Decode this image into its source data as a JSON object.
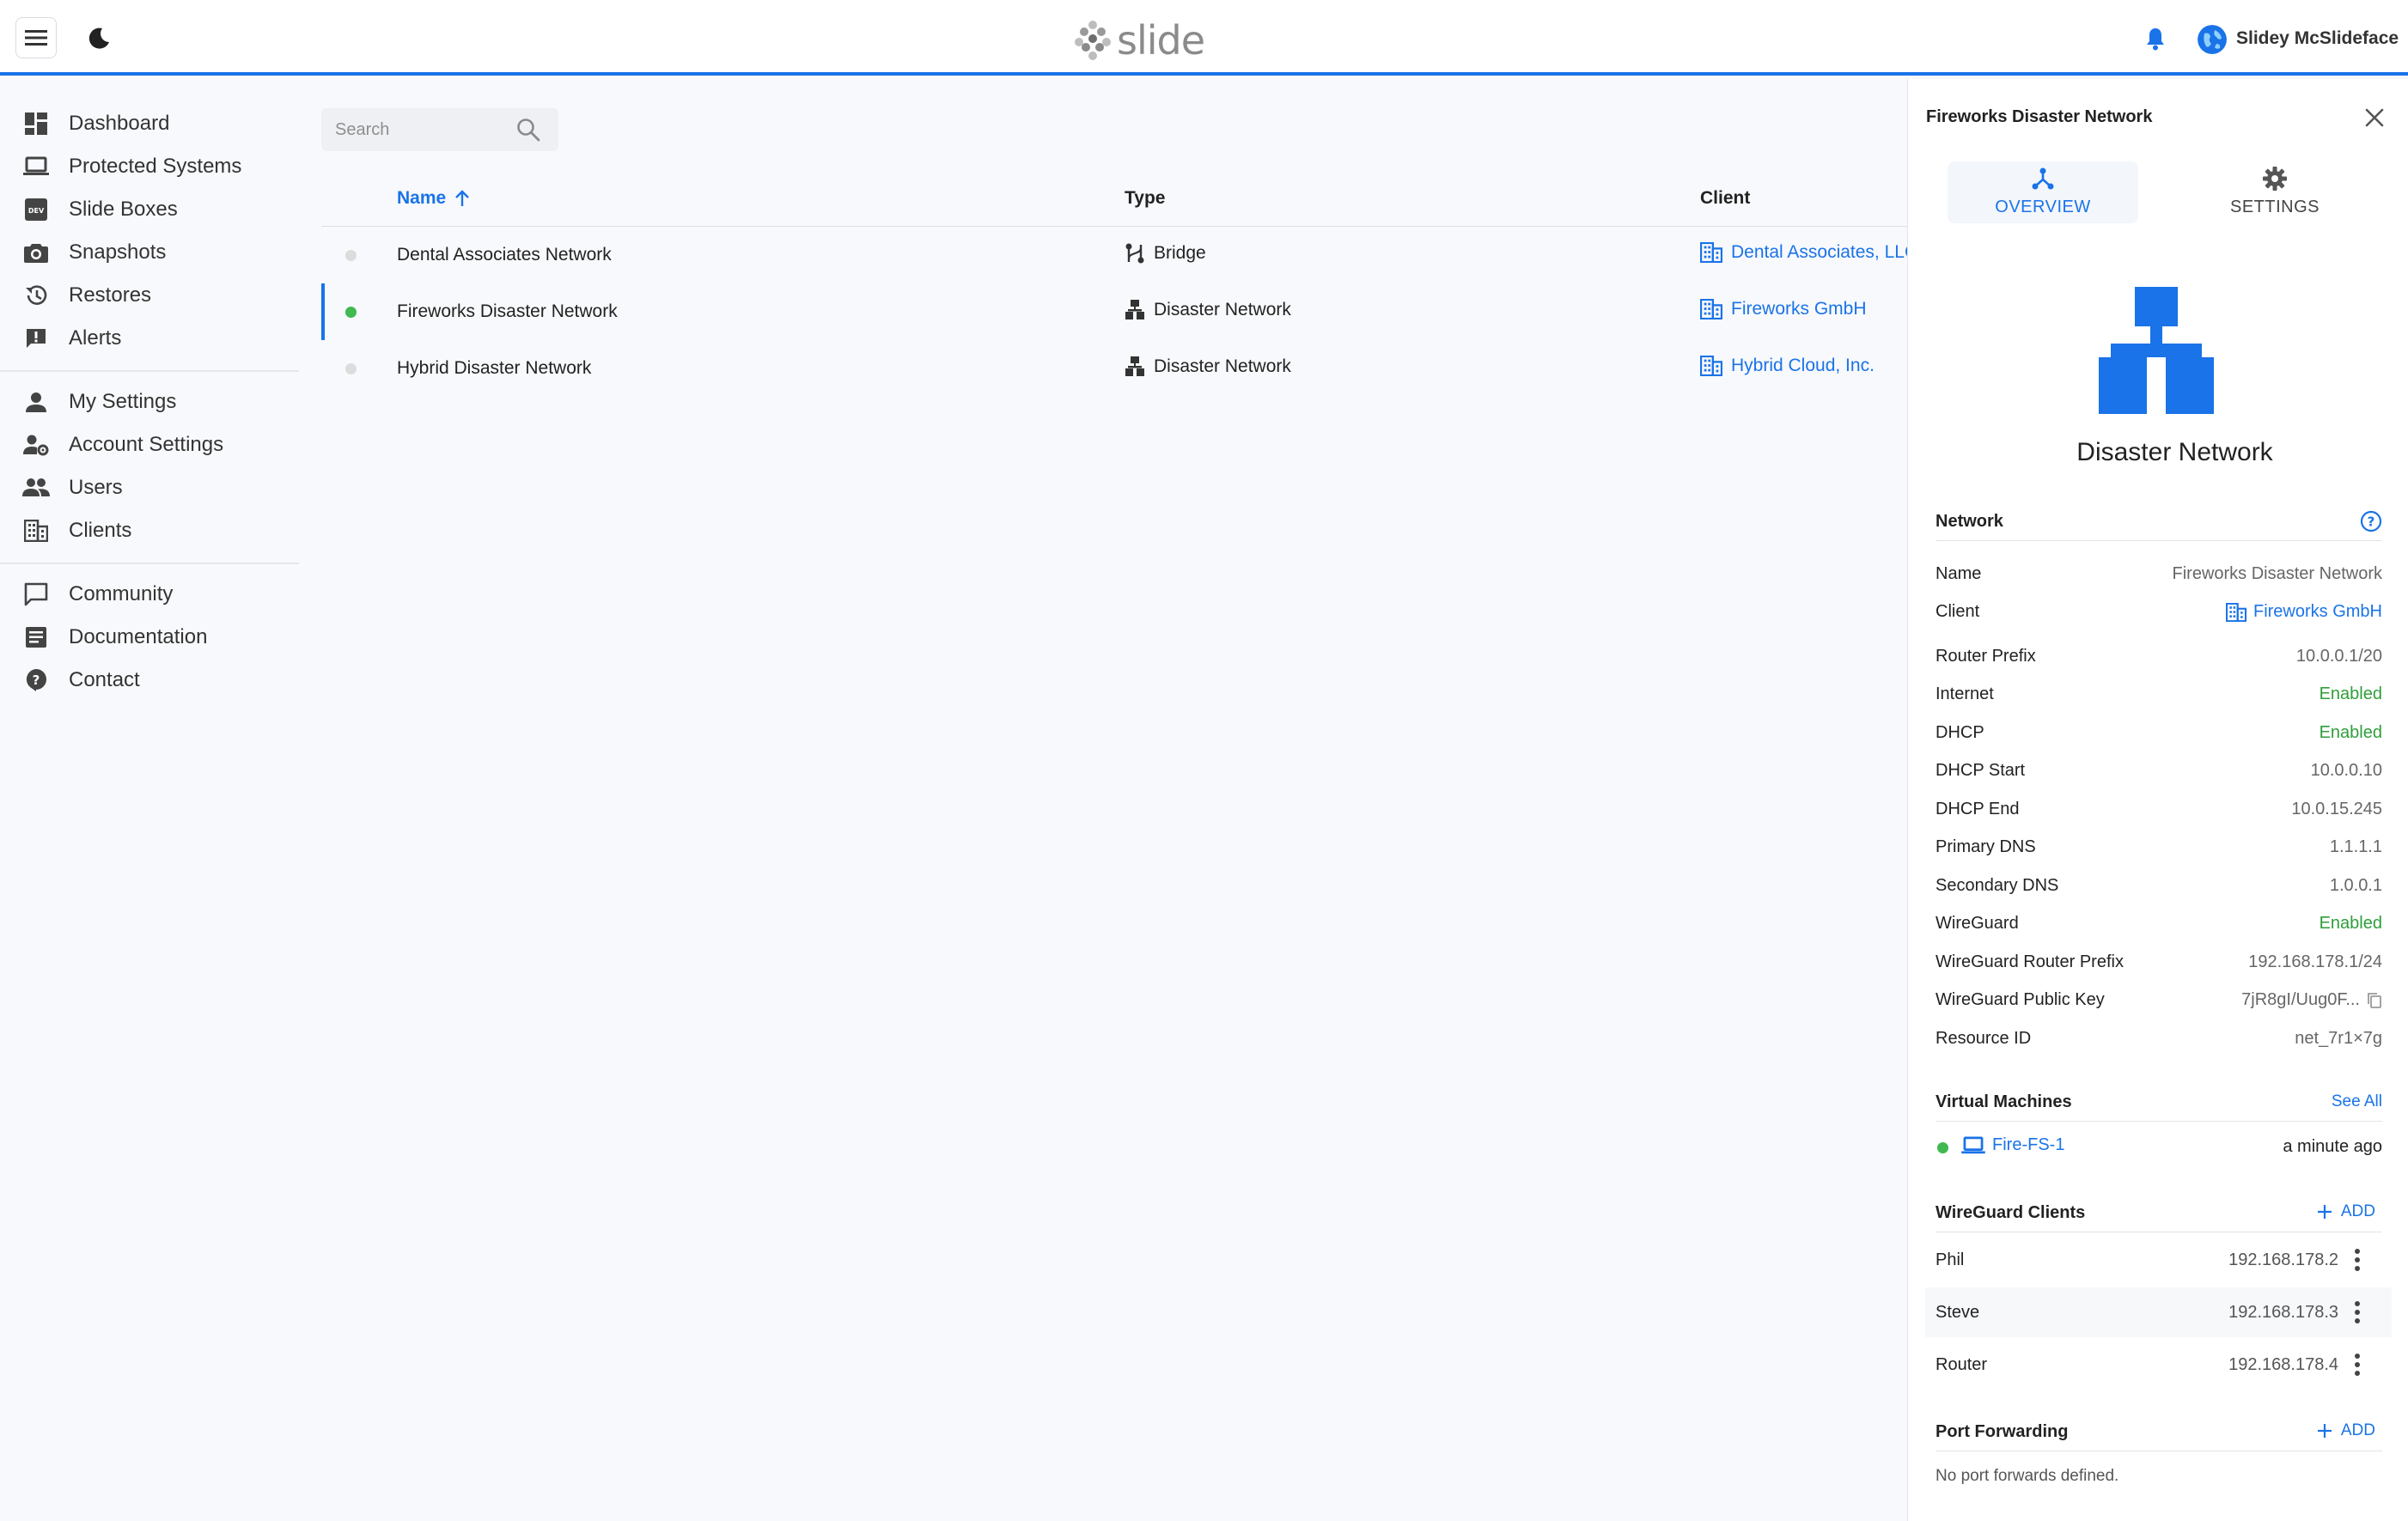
{
  "app": {
    "logo_text": "slide",
    "user_name": "Slidey McSlideface",
    "accent_color": "#1a73e8"
  },
  "sidebar": {
    "groups": [
      [
        {
          "label": "Dashboard",
          "icon": "dashboard-icon"
        },
        {
          "label": "Protected Systems",
          "icon": "laptop-icon"
        },
        {
          "label": "Slide Boxes",
          "icon": "dev-box-icon"
        },
        {
          "label": "Snapshots",
          "icon": "camera-icon"
        },
        {
          "label": "Restores",
          "icon": "history-icon"
        },
        {
          "label": "Alerts",
          "icon": "alert-icon"
        }
      ],
      [
        {
          "label": "My Settings",
          "icon": "person-icon"
        },
        {
          "label": "Account Settings",
          "icon": "person-gear-icon"
        },
        {
          "label": "Users",
          "icon": "users-icon"
        },
        {
          "label": "Clients",
          "icon": "building-icon"
        }
      ],
      [
        {
          "label": "Community",
          "icon": "chat-icon"
        },
        {
          "label": "Documentation",
          "icon": "document-icon"
        },
        {
          "label": "Contact",
          "icon": "help-bubble-icon"
        }
      ]
    ]
  },
  "search": {
    "placeholder": "Search",
    "value": ""
  },
  "table": {
    "columns": {
      "name": "Name",
      "type": "Type",
      "client": "Client"
    },
    "rows": [
      {
        "name": "Dental Associates Network",
        "type": "Bridge",
        "client": "Dental Associates, LLC",
        "status": "inactive",
        "selected": false
      },
      {
        "name": "Fireworks Disaster Network",
        "type": "Disaster Network",
        "client": "Fireworks GmbH",
        "status": "active",
        "selected": true
      },
      {
        "name": "Hybrid Disaster Network",
        "type": "Disaster Network",
        "client": "Hybrid Cloud, Inc.",
        "status": "inactive",
        "selected": false
      }
    ]
  },
  "panel": {
    "title": "Fireworks Disaster Network",
    "tabs": {
      "overview": "OVERVIEW",
      "settings": "SETTINGS"
    },
    "type_title": "Disaster Network",
    "network": {
      "heading": "Network",
      "fields": [
        {
          "key": "Name",
          "value": "Fireworks Disaster Network",
          "style": "plain"
        },
        {
          "key": "Client",
          "value": "Fireworks GmbH",
          "style": "link"
        },
        {
          "key": "Router Prefix",
          "value": "10.0.0.1/20",
          "style": "plain"
        },
        {
          "key": "Internet",
          "value": "Enabled",
          "style": "green"
        },
        {
          "key": "DHCP",
          "value": "Enabled",
          "style": "green"
        },
        {
          "key": "DHCP Start",
          "value": "10.0.0.10",
          "style": "plain"
        },
        {
          "key": "DHCP End",
          "value": "10.0.15.245",
          "style": "plain"
        },
        {
          "key": "Primary DNS",
          "value": "1.1.1.1",
          "style": "plain"
        },
        {
          "key": "Secondary DNS",
          "value": "1.0.0.1",
          "style": "plain"
        },
        {
          "key": "WireGuard",
          "value": "Enabled",
          "style": "green"
        },
        {
          "key": "WireGuard Router Prefix",
          "value": "192.168.178.1/24",
          "style": "plain"
        },
        {
          "key": "WireGuard Public Key",
          "value": "7jR8gI/Uug0F...",
          "style": "copy"
        },
        {
          "key": "Resource ID",
          "value": "net_7r1×7g",
          "style": "plain"
        }
      ]
    },
    "virtual_machines": {
      "heading": "Virtual Machines",
      "see_all": "See All",
      "items": [
        {
          "name": "Fire-FS-1",
          "time": "a minute ago"
        }
      ]
    },
    "wireguard_clients": {
      "heading": "WireGuard Clients",
      "add_label": "ADD",
      "items": [
        {
          "name": "Phil",
          "ip": "192.168.178.2"
        },
        {
          "name": "Steve",
          "ip": "192.168.178.3"
        },
        {
          "name": "Router",
          "ip": "192.168.178.4"
        }
      ]
    },
    "port_forwarding": {
      "heading": "Port Forwarding",
      "add_label": "ADD",
      "empty_text": "No port forwards defined."
    }
  }
}
